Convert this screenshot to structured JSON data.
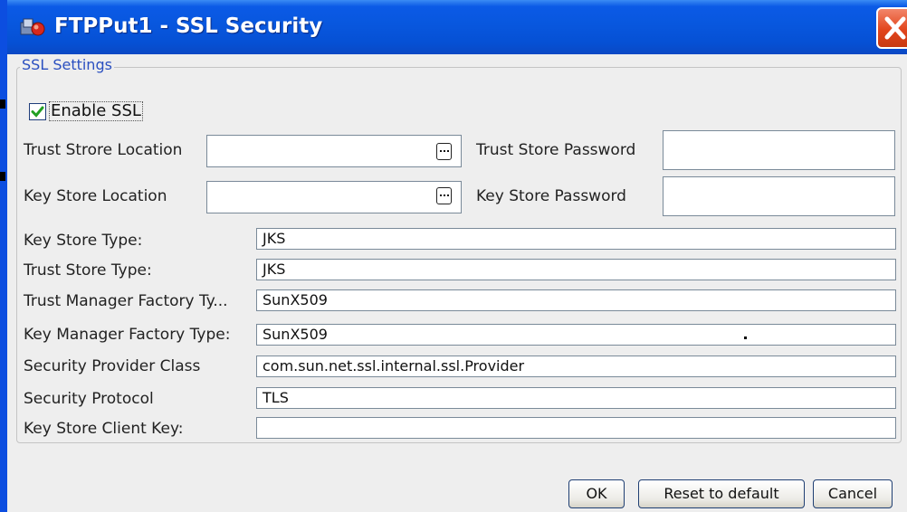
{
  "window": {
    "title": "FTPPut1 - SSL Security"
  },
  "group": {
    "title": "SSL Settings"
  },
  "enable_ssl": {
    "label": "Enable SSL",
    "checked": true
  },
  "fields": {
    "trust_store_location": {
      "label": "Trust Strore Location",
      "value": ""
    },
    "trust_store_password": {
      "label": "Trust Store Password",
      "value": ""
    },
    "key_store_location": {
      "label": "Key Store Location",
      "value": ""
    },
    "key_store_password": {
      "label": "Key Store Password",
      "value": ""
    },
    "key_store_type": {
      "label": "Key Store Type:",
      "value": "JKS"
    },
    "trust_store_type": {
      "label": "Trust Store Type:",
      "value": "JKS"
    },
    "trust_manager_factory_type": {
      "label": "Trust Manager Factory Ty...",
      "value": "SunX509"
    },
    "key_manager_factory_type": {
      "label": "Key Manager Factory Type:",
      "value": "SunX509"
    },
    "security_provider_class": {
      "label": "Security Provider Class",
      "value": "com.sun.net.ssl.internal.ssl.Provider"
    },
    "security_protocol": {
      "label": "Security Protocol",
      "value": "TLS"
    },
    "key_store_client_key": {
      "label": "Key Store Client Key:",
      "value": ""
    }
  },
  "buttons": {
    "ok": "OK",
    "reset": "Reset to default",
    "cancel": "Cancel"
  },
  "icons": {
    "app": "ftp-app-icon",
    "close": "close-icon",
    "browse": "ellipsis-icon",
    "check": "checkmark-icon"
  },
  "colors": {
    "titlebar": "#0857de",
    "close_button": "#e2451c",
    "group_title": "#2a4fc0",
    "checkmark": "#22a022"
  }
}
